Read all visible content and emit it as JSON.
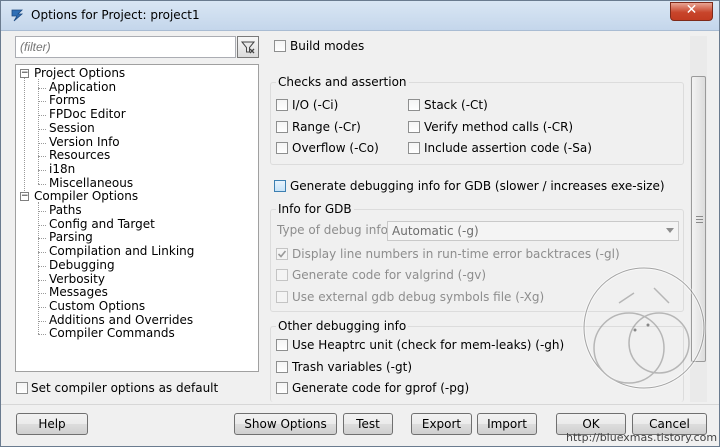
{
  "window": {
    "title": "Options for Project: project1",
    "close_symbol": "✕"
  },
  "filter": {
    "placeholder": "(filter)"
  },
  "tree": {
    "items": [
      {
        "label": "Project Options",
        "level": 0,
        "expander": "−"
      },
      {
        "label": "Application",
        "level": 1
      },
      {
        "label": "Forms",
        "level": 1
      },
      {
        "label": "FPDoc Editor",
        "level": 1
      },
      {
        "label": "Session",
        "level": 1
      },
      {
        "label": "Version Info",
        "level": 1
      },
      {
        "label": "Resources",
        "level": 1
      },
      {
        "label": "i18n",
        "level": 1
      },
      {
        "label": "Miscellaneous",
        "level": 1
      },
      {
        "label": "Compiler Options",
        "level": 0,
        "expander": "−"
      },
      {
        "label": "Paths",
        "level": 1
      },
      {
        "label": "Config and Target",
        "level": 1
      },
      {
        "label": "Parsing",
        "level": 1
      },
      {
        "label": "Compilation and Linking",
        "level": 1
      },
      {
        "label": "Debugging",
        "level": 1
      },
      {
        "label": "Verbosity",
        "level": 1
      },
      {
        "label": "Messages",
        "level": 1
      },
      {
        "label": "Custom Options",
        "level": 1
      },
      {
        "label": "Additions and Overrides",
        "level": 1
      },
      {
        "label": "Compiler Commands",
        "level": 1
      }
    ]
  },
  "set_default": {
    "label": "Set compiler options as default"
  },
  "build_modes": {
    "label": "Build modes"
  },
  "checks": {
    "title": "Checks and assertion",
    "io": "I/O (-Ci)",
    "range": "Range (-Cr)",
    "overflow": "Overflow (-Co)",
    "stack": "Stack (-Ct)",
    "verify": "Verify method calls (-CR)",
    "assertion": "Include assertion code (-Sa)"
  },
  "gdb_toggle": {
    "label": "Generate debugging info for GDB (slower / increases exe-size)"
  },
  "info_gdb": {
    "title": "Info for GDB",
    "type_label": "Type of debug info",
    "type_value": "Automatic (-g)",
    "display_lines": "Display line numbers in run-time error backtraces (-gl)",
    "valgrind": "Generate code for valgrind (-gv)",
    "external": "Use external gdb debug symbols file (-Xg)"
  },
  "other_debug": {
    "title": "Other debugging info",
    "heaptrc": "Use Heaptrc unit (check for mem-leaks) (-gh)",
    "trash": "Trash variables (-gt)",
    "gprof": "Generate code for gprof (-pg)"
  },
  "buttons": {
    "help": "Help",
    "show_options": "Show Options",
    "test": "Test",
    "export": "Export",
    "import": "Import",
    "ok": "OK",
    "cancel": "Cancel"
  },
  "watermark": "http://bluexmas.tistory.com"
}
